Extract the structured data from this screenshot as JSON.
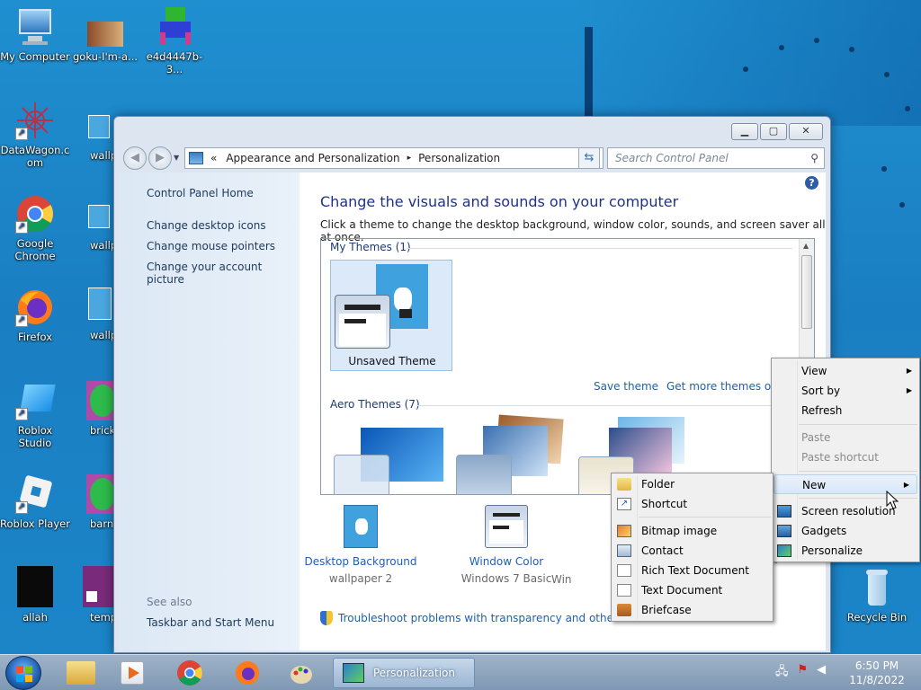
{
  "desktop": {
    "icons": [
      {
        "label": "My Computer",
        "icon": "computer-icon"
      },
      {
        "label": "goku-I'm-a...",
        "icon": "image-icon"
      },
      {
        "label": "e4d4447b-3...",
        "icon": "image-icon"
      },
      {
        "label": "DataWagon.c om",
        "icon": "datawagon-icon"
      },
      {
        "label": "wallpa",
        "icon": "image-icon"
      },
      {
        "label": "Google Chrome",
        "icon": "chrome-icon"
      },
      {
        "label": "wallpap",
        "icon": "image-icon"
      },
      {
        "label": "Firefox",
        "icon": "firefox-icon"
      },
      {
        "label": "wallpap",
        "icon": "image-icon"
      },
      {
        "label": "Roblox Studio",
        "icon": "roblox-studio-icon"
      },
      {
        "label": "brick t-shi",
        "icon": "image-icon"
      },
      {
        "label": "Roblox Player",
        "icon": "roblox-player-icon"
      },
      {
        "label": "barney",
        "icon": "image-icon"
      },
      {
        "label": "allah",
        "icon": "image-icon"
      },
      {
        "label": "template",
        "icon": "image-icon"
      },
      {
        "label": "Recycle Bin",
        "icon": "recycle-bin-icon"
      }
    ]
  },
  "window": {
    "address": {
      "prefix": "«",
      "crumb1": "Appearance and Personalization",
      "sep": "▸",
      "crumb2": "Personalization"
    },
    "search_placeholder": "Search Control Panel",
    "sidebar": {
      "home": "Control Panel Home",
      "links": [
        "Change desktop icons",
        "Change mouse pointers",
        "Change your account picture"
      ],
      "see_also": "See also",
      "see_also_links": [
        "Taskbar and Start Menu"
      ]
    },
    "heading": "Change the visuals and sounds on your computer",
    "subheading": "Click a theme to change the desktop background, window color, sounds, and screen saver all at once.",
    "my_themes_label": "My Themes (1)",
    "unsaved_theme": "Unsaved Theme",
    "save_theme": "Save theme",
    "get_more_themes": "Get more themes onli",
    "aero_label": "Aero Themes (7)",
    "bottom_items": [
      {
        "label": "Desktop Background",
        "sub": "wallpaper 2"
      },
      {
        "label": "Window Color",
        "sub": "Windows 7 Basic"
      },
      {
        "label": "",
        "sub": "Win"
      }
    ],
    "partial_er": "er",
    "troubleshoot": "Troubleshoot problems with transparency and other Aero"
  },
  "context_menu": {
    "items": [
      {
        "label": "View",
        "submenu": true
      },
      {
        "label": "Sort by",
        "submenu": true
      },
      {
        "label": "Refresh"
      },
      {
        "label": "Paste",
        "disabled": true
      },
      {
        "label": "Paste shortcut",
        "disabled": true
      },
      {
        "label": "New",
        "submenu": true
      },
      {
        "label": "Screen resolution"
      },
      {
        "label": "Gadgets"
      },
      {
        "label": "Personalize"
      }
    ]
  },
  "new_submenu": {
    "items": [
      {
        "label": "Folder",
        "icon": "folder-icon"
      },
      {
        "label": "Shortcut",
        "icon": "shortcut-icon"
      },
      {
        "label": "Bitmap image",
        "icon": "bitmap-icon"
      },
      {
        "label": "Contact",
        "icon": "contact-icon"
      },
      {
        "label": "Rich Text Document",
        "icon": "rtf-icon"
      },
      {
        "label": "Text Document",
        "icon": "text-document-icon"
      },
      {
        "label": "Briefcase",
        "icon": "briefcase-icon"
      }
    ]
  },
  "taskbar": {
    "active_window": "Personalization",
    "time": "6:50 PM",
    "date": "11/8/2022"
  },
  "colors": {
    "desktop": "#1a84c7",
    "link": "#1f5fb2",
    "heading": "#1e3287"
  }
}
